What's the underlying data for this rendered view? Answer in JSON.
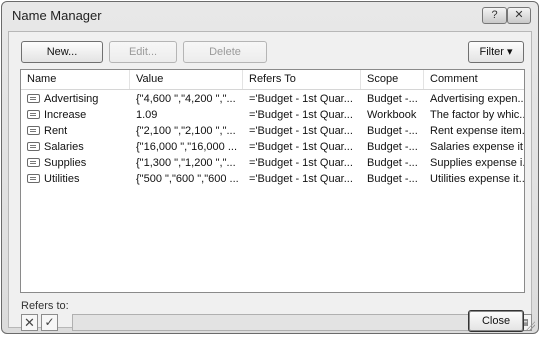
{
  "dialog": {
    "title": "Name Manager",
    "help_label": "?",
    "close_x_label": "✕"
  },
  "toolbar": {
    "new_label": "New...",
    "edit_label": "Edit...",
    "delete_label": "Delete",
    "filter_label": "Filter ▾"
  },
  "table": {
    "columns": [
      "Name",
      "Value",
      "Refers To",
      "Scope",
      "Comment"
    ],
    "rows": [
      {
        "name": "Advertising",
        "value": "{\"4,600 \",\"4,200 \",\"...",
        "refers_to": "='Budget - 1st Quar...",
        "scope": "Budget -...",
        "comment": "Advertising expen..."
      },
      {
        "name": "Increase",
        "value": "1.09",
        "refers_to": "='Budget - 1st Quar...",
        "scope": "Workbook",
        "comment": "The factor by whic..."
      },
      {
        "name": "Rent",
        "value": "{\"2,100 \",\"2,100 \",\"...",
        "refers_to": "='Budget - 1st Quar...",
        "scope": "Budget -...",
        "comment": "Rent expense item..."
      },
      {
        "name": "Salaries",
        "value": "{\"16,000 \",\"16,000 ...",
        "refers_to": "='Budget - 1st Quar...",
        "scope": "Budget -...",
        "comment": "Salaries expense it..."
      },
      {
        "name": "Supplies",
        "value": "{\"1,300 \",\"1,200 \",\"...",
        "refers_to": "='Budget - 1st Quar...",
        "scope": "Budget -...",
        "comment": "Supplies expense i..."
      },
      {
        "name": "Utilities",
        "value": "{\"500 \",\"600 \",\"600 ...",
        "refers_to": "='Budget - 1st Quar...",
        "scope": "Budget -...",
        "comment": "Utilities expense it..."
      }
    ]
  },
  "refers": {
    "label": "Refers to:",
    "value": "",
    "cancel_icon": "✕",
    "ok_icon": "✓",
    "collapse_icon": "▤"
  },
  "footer": {
    "close_label": "Close"
  }
}
